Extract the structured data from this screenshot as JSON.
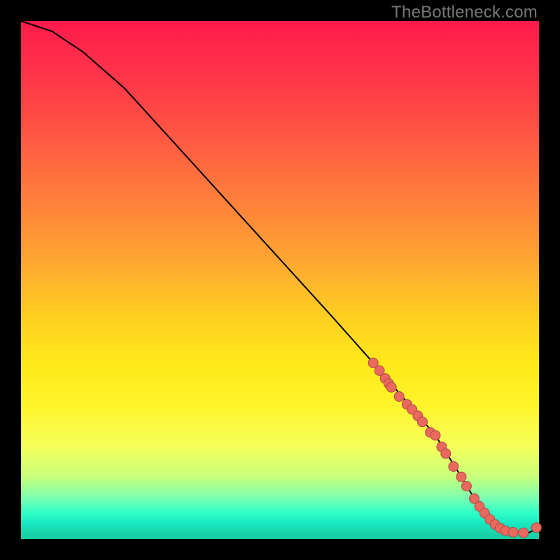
{
  "watermark": "TheBottleneck.com",
  "colors": {
    "marker_fill": "#e9695e",
    "marker_stroke": "#b04a46",
    "curve_stroke": "#000000",
    "background": "#000000"
  },
  "chart_data": {
    "type": "line",
    "title": "",
    "xlabel": "",
    "ylabel": "",
    "xlim": [
      0,
      100
    ],
    "ylim": [
      0,
      100
    ],
    "grid": false,
    "curve": {
      "x": [
        0,
        6,
        12,
        20,
        30,
        40,
        50,
        60,
        68,
        74,
        80,
        85,
        88,
        90,
        92,
        94,
        96,
        98,
        100
      ],
      "y": [
        100,
        98,
        94,
        87,
        76,
        65,
        54,
        43,
        34,
        27,
        20,
        12,
        7,
        4,
        2,
        1.4,
        1.2,
        1.2,
        2.2
      ]
    },
    "series": [
      {
        "name": "highlighted-range",
        "type": "scatter",
        "x": [
          68.0,
          69.2,
          70.3,
          71.0,
          71.5,
          73.0,
          74.5,
          75.5,
          76.6,
          77.5,
          79.0,
          80.0,
          81.2,
          82.0,
          83.5,
          85.0,
          86.0,
          87.5,
          88.5,
          89.5,
          90.5,
          91.5,
          92.5,
          93.5,
          95.0,
          97.0,
          99.5
        ],
        "y": [
          34.0,
          32.5,
          31.0,
          30.0,
          29.3,
          27.5,
          26.0,
          25.0,
          23.8,
          22.6,
          20.6,
          20.0,
          17.8,
          16.5,
          14.0,
          12.0,
          10.2,
          7.8,
          6.3,
          5.0,
          3.8,
          2.8,
          2.1,
          1.6,
          1.3,
          1.2,
          2.2
        ]
      }
    ]
  }
}
